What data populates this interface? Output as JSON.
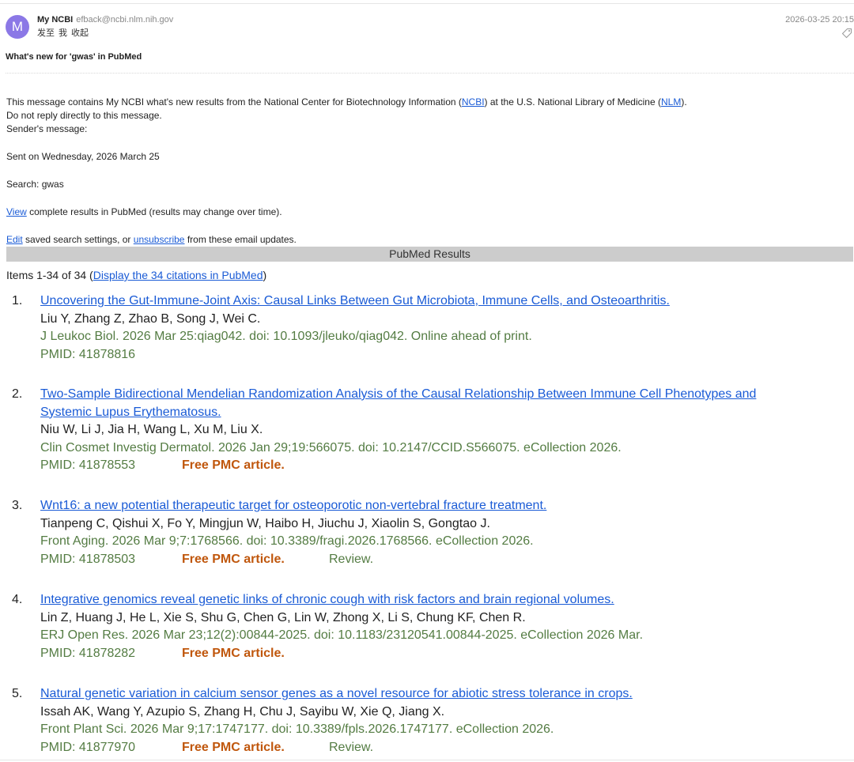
{
  "header": {
    "avatar_letter": "M",
    "sender_name": "My NCBI",
    "sender_email": "efback@ncbi.nlm.nih.gov",
    "recipient_line": [
      "发至",
      "我",
      "收起"
    ],
    "date": "2026-03-25 20:15",
    "tag_icon": "tag-icon",
    "subject": "What's new for 'gwas' in PubMed"
  },
  "message": {
    "intro_pre": "This message contains My NCBI what's new results from the National Center for Biotechnology Information (",
    "ncbi_link": "NCBI",
    "intro_mid": ") at the U.S. National Library of Medicine (",
    "nlm_link": "NLM",
    "intro_post": ").",
    "no_reply": "Do not reply directly to this message.",
    "sender_msg": "Sender's message:",
    "sent_on": "Sent on Wednesday, 2026 March 25",
    "search": "Search: gwas",
    "view_link": "View",
    "view_rest": " complete results in PubMed (results may change over time).",
    "edit_link": "Edit",
    "edit_mid": " saved search settings, or ",
    "unsub_link": "unsubscribe",
    "edit_post": " from these email updates."
  },
  "results_bar": "PubMed Results",
  "items_summary": {
    "pre": "Items 1-34 of 34 (",
    "link": "Display the 34 citations in PubMed",
    "post": ")"
  },
  "results": [
    {
      "num": "1.",
      "title_lines": [
        "Uncovering the Gut-Immune-Joint Axis: Causal Links Between Gut Microbiota, Immune Cells, and Osteoarthritis."
      ],
      "authors": "Liu Y, Zhang Z, Zhao B, Song J, Wei C.",
      "source": "J Leukoc Biol. 2026 Mar 25:qiag042. doi: 10.1093/jleuko/qiag042. Online ahead of print.",
      "pmid": "PMID: 41878816",
      "free": "",
      "review": ""
    },
    {
      "num": "2.",
      "title_lines": [
        "Two-Sample Bidirectional Mendelian Randomization Analysis of the Causal Relationship Between Immune Cell Phenotypes and",
        "Systemic Lupus Erythematosus."
      ],
      "authors": "Niu W, Li J, Jia H, Wang L, Xu M, Liu X.",
      "source": "Clin Cosmet Investig Dermatol. 2026 Jan 29;19:566075. doi: 10.2147/CCID.S566075. eCollection 2026.",
      "pmid": "PMID: 41878553",
      "free": "Free PMC article.",
      "review": ""
    },
    {
      "num": "3.",
      "title_lines": [
        "Wnt16: a new potential therapeutic target for osteoporotic non-vertebral fracture treatment."
      ],
      "authors": "Tianpeng C, Qishui X, Fo Y, Mingjun W, Haibo H, Jiuchu J, Xiaolin S, Gongtao J.",
      "source": "Front Aging. 2026 Mar 9;7:1768566. doi: 10.3389/fragi.2026.1768566. eCollection 2026.",
      "pmid": "PMID: 41878503",
      "free": "Free PMC article.",
      "review": "Review."
    },
    {
      "num": "4.",
      "title_lines": [
        "Integrative genomics reveal genetic links of chronic cough with risk factors and brain regional volumes."
      ],
      "authors": "Lin Z, Huang J, He L, Xie S, Shu G, Chen G, Lin W, Zhong X, Li S, Chung KF, Chen R.",
      "source": "ERJ Open Res. 2026 Mar 23;12(2):00844-2025. doi: 10.1183/23120541.00844-2025. eCollection 2026 Mar.",
      "pmid": "PMID: 41878282",
      "free": "Free PMC article.",
      "review": ""
    },
    {
      "num": "5.",
      "title_lines": [
        "Natural genetic variation in calcium sensor genes as a novel resource for abiotic stress tolerance in crops."
      ],
      "authors": "Issah AK, Wang Y, Azupio S, Zhang H, Chu J, Sayibu W, Xie Q, Jiang X.",
      "source": "Front Plant Sci. 2026 Mar 9;17:1747177. doi: 10.3389/fpls.2026.1747177. eCollection 2026.",
      "pmid": "PMID: 41877970",
      "free": "Free PMC article.",
      "review": "Review."
    }
  ]
}
